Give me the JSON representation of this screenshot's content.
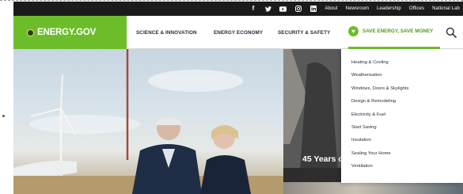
{
  "topbar": {
    "social_icons": [
      "facebook-icon",
      "twitter-icon",
      "youtube-icon",
      "instagram-icon",
      "linkedin-icon"
    ],
    "social_glyphs": [
      "f",
      "t",
      "▶",
      "◎",
      "in"
    ],
    "links": [
      "About",
      "Newsroom",
      "Leadership",
      "Offices",
      "National Lab"
    ]
  },
  "logo": {
    "text": "ENERGY.GOV"
  },
  "nav": {
    "items": [
      "SCIENCE & INNOVATION",
      "ENERGY ECONOMY",
      "SECURITY & SAFETY"
    ],
    "save_energy": "SAVE ENERGY, SAVE MONEY"
  },
  "dropdown": {
    "items": [
      "Heating & Cooling",
      "Weatherization",
      "Windows, Doors & Skylights",
      "Design & Remodeling",
      "Electricity & Fuel",
      "Start Saving",
      "Insulation",
      "Sealing Your Home",
      "Ventilation"
    ]
  },
  "hero": {
    "caption": "45 Years o"
  },
  "colors": {
    "brand_green": "#6dbd2b",
    "topbar_bg": "#1b1b1b",
    "nav_text": "#1e2a36"
  }
}
